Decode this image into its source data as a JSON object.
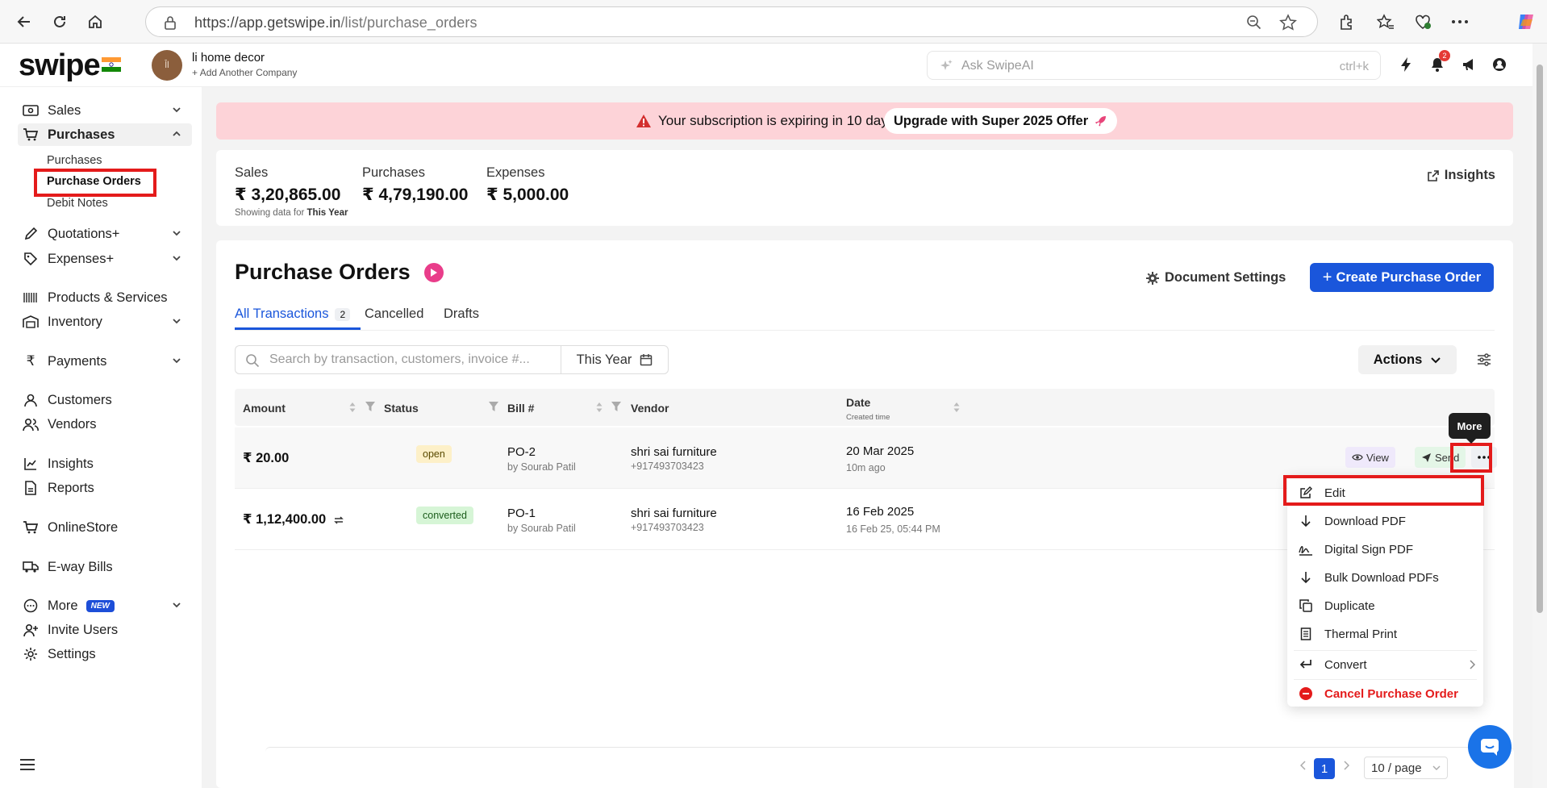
{
  "browser": {
    "url_host": "https://app.getswipe.in",
    "url_path": "/list/purchase_orders"
  },
  "header": {
    "logo": "swipe",
    "company_avatar_text": "ꟾ̄ꟾ",
    "company_name": "li home decor",
    "add_company": "Add Another Company",
    "ask_placeholder": "Ask SwipeAI",
    "ask_shortcut": "ctrl+k",
    "notification_count": "2"
  },
  "sidebar": {
    "sales": "Sales",
    "purchases": "Purchases",
    "sub_purchases": "Purchases",
    "sub_purchase_orders": "Purchase Orders",
    "sub_debit_notes": "Debit Notes",
    "quotations": "Quotations+",
    "expenses": "Expenses+",
    "products": "Products & Services",
    "inventory": "Inventory",
    "payments": "Payments",
    "customers": "Customers",
    "vendors": "Vendors",
    "insights": "Insights",
    "reports": "Reports",
    "online_store": "OnlineStore",
    "eway": "E-way Bills",
    "more": "More",
    "new_badge": "NEW",
    "invite": "Invite Users",
    "settings": "Settings"
  },
  "banner": {
    "text": "Your subscription is expiring in 10 days!",
    "upgrade": "Upgrade with Super 2025 Offer"
  },
  "stats": {
    "sales_label": "Sales",
    "sales_value": "₹ 3,20,865.00",
    "purchases_label": "Purchases",
    "purchases_value": "₹ 4,79,190.00",
    "expenses_label": "Expenses",
    "expenses_value": "₹ 5,000.00",
    "note_prefix": "Showing data for",
    "note_period": "This Year",
    "insights": "Insights"
  },
  "page": {
    "title": "Purchase Orders",
    "doc_settings": "Document Settings",
    "create": "Create Purchase Order",
    "tab_all": "All Transactions",
    "tab_all_count": "2",
    "tab_cancelled": "Cancelled",
    "tab_drafts": "Drafts",
    "search_placeholder": "Search by transaction, customers, invoice #...",
    "year_filter": "This Year",
    "actions": "Actions"
  },
  "table": {
    "columns": {
      "amount": "Amount",
      "status": "Status",
      "bill": "Bill #",
      "vendor": "Vendor",
      "date": "Date",
      "date_sub": "Created time"
    },
    "rows": [
      {
        "amount": "₹ 20.00",
        "status": "open",
        "bill": "PO-2",
        "by": "by Sourab Patil",
        "vendor": "shri sai furniture",
        "phone": "+917493703423",
        "date": "20 Mar 2025",
        "ago": "10m ago"
      },
      {
        "amount": "₹ 1,12,400.00",
        "status": "converted",
        "bill": "PO-1",
        "by": "by Sourab Patil",
        "vendor": "shri sai furniture",
        "phone": "+917493703423",
        "date": "16 Feb 2025",
        "ago": "16 Feb 25, 05:44 PM"
      }
    ],
    "view": "View",
    "send": "Send"
  },
  "tooltip": "More",
  "menu": {
    "edit": "Edit",
    "download": "Download PDF",
    "sign": "Digital Sign PDF",
    "bulk": "Bulk Download PDFs",
    "duplicate": "Duplicate",
    "thermal": "Thermal Print",
    "convert": "Convert",
    "cancel": "Cancel Purchase Order"
  },
  "pagination": {
    "page": "1",
    "page_size": "10 / page"
  },
  "colors": {
    "primary": "#1a56db",
    "highlight": "#e41b1b",
    "banner": "#fdd3d8"
  }
}
